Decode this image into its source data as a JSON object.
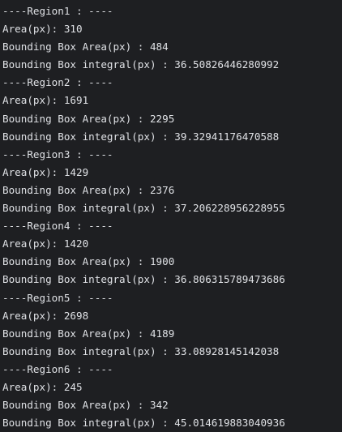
{
  "console": {
    "lines": [
      "----Region1 : ----",
      "Area(px): 310",
      "Bounding Box Area(px) : 484",
      "Bounding Box integral(px) : 36.50826446280992",
      "----Region2 : ----",
      "Area(px): 1691",
      "Bounding Box Area(px) : 2295",
      "Bounding Box integral(px) : 39.32941176470588",
      "----Region3 : ----",
      "Area(px): 1429",
      "Bounding Box Area(px) : 2376",
      "Bounding Box integral(px) : 37.206228956228955",
      "----Region4 : ----",
      "Area(px): 1420",
      "Bounding Box Area(px) : 1900",
      "Bounding Box integral(px) : 36.806315789473686",
      "----Region5 : ----",
      "Area(px): 2698",
      "Bounding Box Area(px) : 4189",
      "Bounding Box integral(px) : 33.08928145142038",
      "----Region6 : ----",
      "Area(px): 245",
      "Bounding Box Area(px) : 342",
      "Bounding Box integral(px) : 45.014619883040936"
    ]
  },
  "colors": {
    "background": "#1e1f22",
    "text": "#dfe1e5"
  }
}
